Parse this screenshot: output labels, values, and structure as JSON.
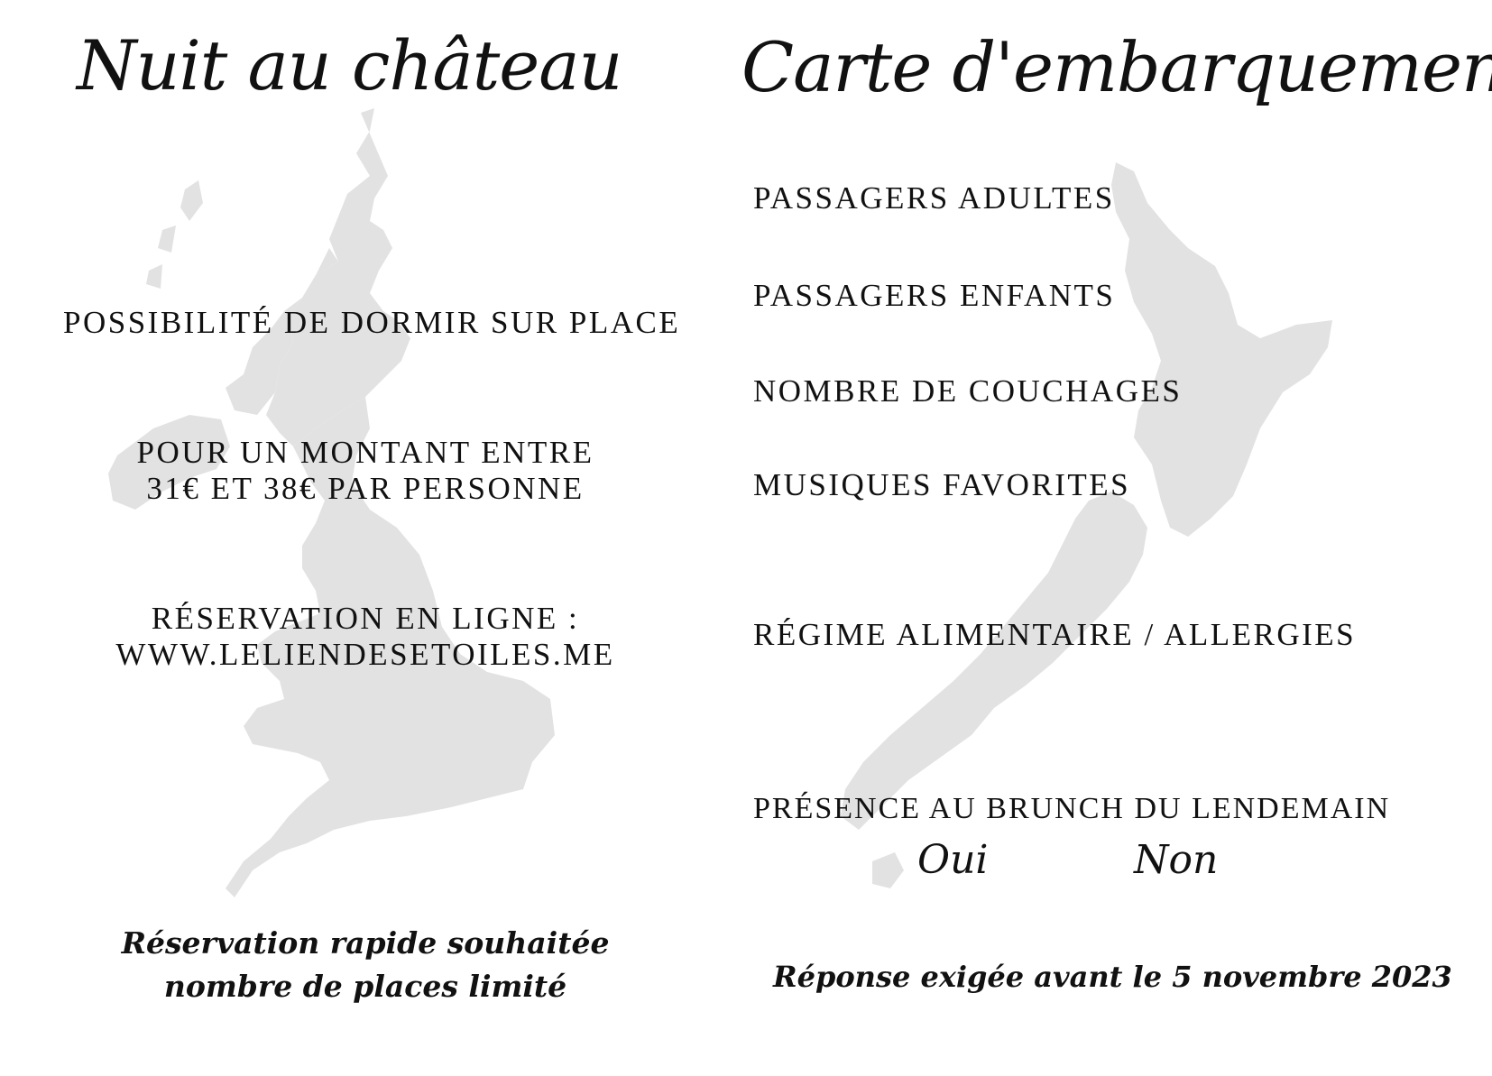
{
  "left_card": {
    "title": "Nuit au château",
    "sleep_option": "POSSIBILITÉ DE DORMIR SUR PLACE",
    "price_line1": "POUR UN MONTANT ENTRE",
    "price_line2": "31€ ET 38€ PAR PERSONNE",
    "booking_line1": "RÉSERVATION EN LIGNE :",
    "booking_line2": "WWW.LELIENDESETOILES.ME",
    "footer_line1": "Réservation rapide souhaitée",
    "footer_line2": "nombre de places limité",
    "background_map_icon": "great-britain-map-silhouette"
  },
  "right_card": {
    "title": "Carte d'embarquement",
    "fields": [
      "PASSAGERS ADULTES",
      "PASSAGERS ENFANTS",
      "NOMBRE DE COUCHAGES",
      "MUSIQUES FAVORITES",
      "RÉGIME ALIMENTAIRE / ALLERGIES",
      "PRÉSENCE AU BRUNCH DU LENDEMAIN"
    ],
    "option_yes": "Oui",
    "option_no": "Non",
    "footer": "Réponse exigée avant le 5 novembre 2023",
    "background_map_icon": "new-zealand-map-silhouette"
  },
  "colors": {
    "map_fill": "#e2e2e2",
    "text": "#111111",
    "background": "#ffffff"
  }
}
